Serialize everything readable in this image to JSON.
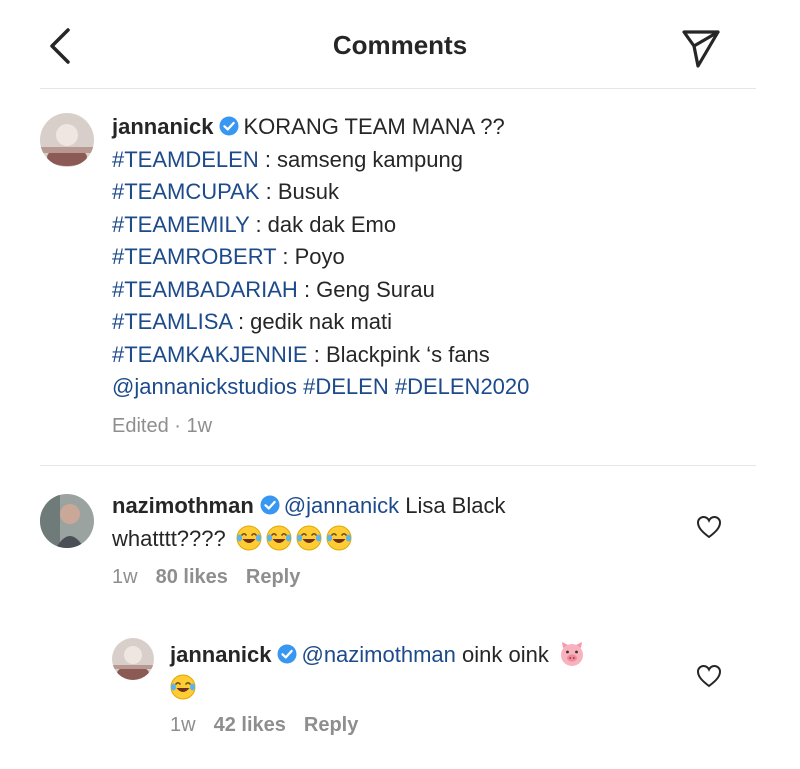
{
  "header": {
    "title": "Comments"
  },
  "caption": {
    "username": "jannanick",
    "first_line": "KORANG TEAM MANA ??",
    "lines": [
      {
        "tag": "#TEAMDELEN",
        "text": " : samseng kampung"
      },
      {
        "tag": "#TEAMCUPAK",
        "text": " : Busuk"
      },
      {
        "tag": "#TEAMEMILY",
        "text": " : dak dak Emo"
      },
      {
        "tag": "#TEAMROBERT",
        "text": " : Poyo"
      },
      {
        "tag": "#TEAMBADARIAH",
        "text": " : Geng Surau"
      },
      {
        "tag": "#TEAMLISA",
        "text": " : gedik nak mati"
      },
      {
        "tag": "#TEAMKAKJENNIE",
        "text": " : Blackpink ‘s fans"
      }
    ],
    "mention": "@jannanickstudios",
    "tag1": "#DELEN",
    "tag2": "#DELEN2020",
    "meta": "Edited · 1w"
  },
  "comments": [
    {
      "username": "nazimothman",
      "mention": "@jannanick",
      "text1": " Lisa Black",
      "text2": "whatttt????",
      "emojis": [
        "laughing-crying",
        "laughing-crying",
        "laughing-crying",
        "laughing-crying"
      ],
      "time": "1w",
      "likes": "80 likes",
      "reply": "Reply"
    },
    {
      "username": "jannanick",
      "mention": "@nazimothman",
      "text1": " oink oink",
      "emojis": [
        "pig-face",
        "laughing-crying"
      ],
      "time": "1w",
      "likes": "42 likes",
      "reply": "Reply"
    }
  ],
  "colors": {
    "hashtag": "#1c4a8a",
    "verified": "#3897f0",
    "meta": "#8e8e8e"
  }
}
